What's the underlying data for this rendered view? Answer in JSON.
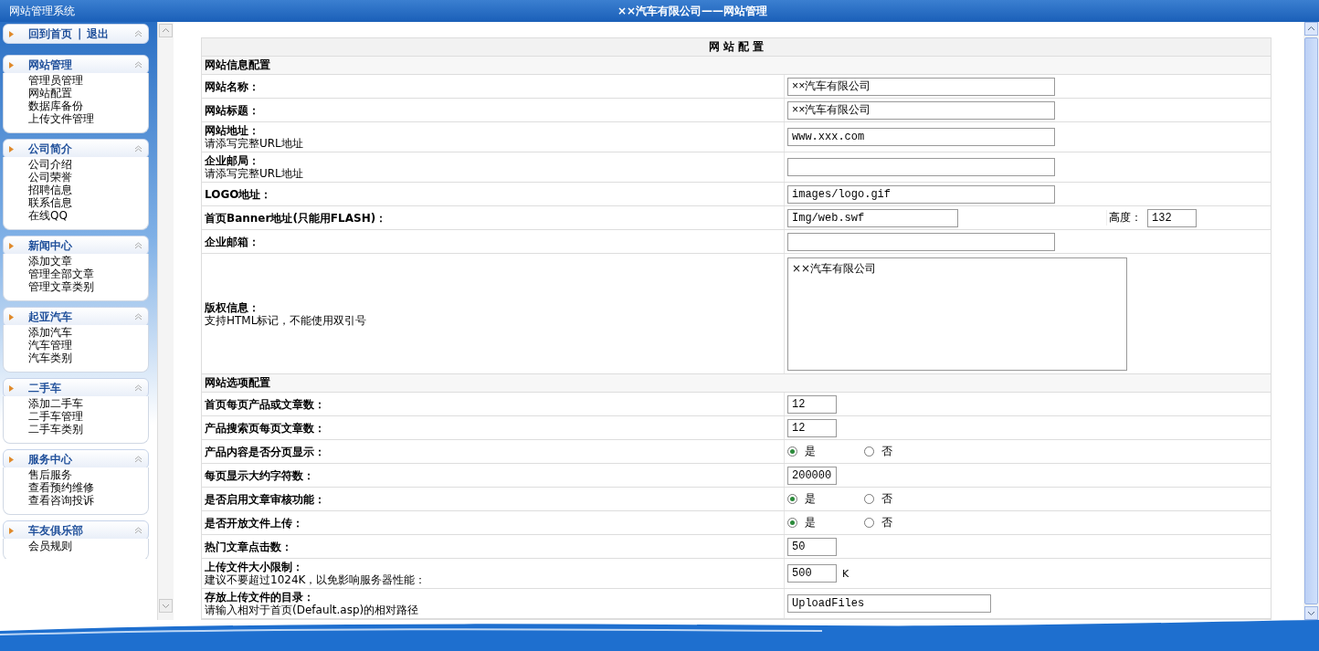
{
  "top_bar": {
    "app_name": "网站管理系统",
    "title": "××汽车有限公司——网站管理"
  },
  "sidebar": {
    "quick_links": [
      {
        "label": "回到首页"
      },
      {
        "label": "退出"
      }
    ],
    "separator": "|",
    "groups": [
      {
        "title": "网站管理",
        "expanded": true,
        "items": [
          "管理员管理",
          "网站配置",
          "数据库备份",
          "上传文件管理"
        ]
      },
      {
        "title": "公司简介",
        "expanded": true,
        "items": [
          "公司介绍",
          "公司荣誉",
          "招聘信息",
          "联系信息",
          "在线QQ"
        ]
      },
      {
        "title": "新闻中心",
        "expanded": true,
        "items": [
          "添加文章",
          "管理全部文章",
          "管理文章类别"
        ]
      },
      {
        "title": "起亚汽车",
        "expanded": true,
        "items": [
          "添加汽车",
          "汽车管理",
          "汽车类别"
        ]
      },
      {
        "title": "二手车",
        "expanded": true,
        "items": [
          "添加二手车",
          "二手车管理",
          "二手车类别"
        ]
      },
      {
        "title": "服务中心",
        "expanded": true,
        "items": [
          "售后服务",
          "查看预约维修",
          "查看咨询投诉"
        ]
      },
      {
        "title": "车友俱乐部",
        "expanded": true,
        "items": [
          "会员规则"
        ]
      }
    ]
  },
  "form": {
    "title": "网 站 配 置",
    "rows": [
      {
        "kind": "section",
        "label": "网站信息配置"
      },
      {
        "kind": "field",
        "label": "网站名称：",
        "control": {
          "kind": "long",
          "value": "××汽车有限公司"
        }
      },
      {
        "kind": "field",
        "label": "网站标题：",
        "control": {
          "kind": "long",
          "value": "××汽车有限公司"
        }
      },
      {
        "kind": "field",
        "label": "网站地址：",
        "hint": "请添写完整URL地址",
        "control": {
          "kind": "long",
          "value": "www.xxx.com"
        }
      },
      {
        "kind": "field",
        "label": "企业邮局：",
        "hint": "请添写完整URL地址",
        "control": {
          "kind": "long"
        }
      },
      {
        "kind": "field",
        "label": "LOGO地址：",
        "control": {
          "kind": "long",
          "value": "images/logo.gif"
        }
      },
      {
        "kind": "field",
        "label": "首页Banner地址(只能用FLASH)：",
        "control": {
          "kind": "banner",
          "value": "Img/web.swf",
          "extra_label": "高度：",
          "extra_value": "132"
        }
      },
      {
        "kind": "field",
        "label": "企业邮箱：",
        "control": {
          "kind": "long"
        }
      },
      {
        "kind": "field",
        "label": "版权信息：",
        "hint": "支持HTML标记，不能使用双引号",
        "control": {
          "kind": "textarea",
          "value": "××汽车有限公司"
        }
      },
      {
        "kind": "section",
        "label": "网站选项配置"
      },
      {
        "kind": "field",
        "label": "首页每页产品或文章数：",
        "control": {
          "kind": "short",
          "value": "12"
        }
      },
      {
        "kind": "field",
        "label": "产品搜索页每页文章数：",
        "control": {
          "kind": "short",
          "value": "12"
        }
      },
      {
        "kind": "field",
        "label": "产品内容是否分页显示：",
        "control": {
          "kind": "radio",
          "options": [
            {
              "label": "是",
              "selected": true
            },
            {
              "label": "否",
              "selected": false
            }
          ]
        }
      },
      {
        "kind": "field",
        "label": "每页显示大约字符数：",
        "control": {
          "kind": "short",
          "value": "200000"
        }
      },
      {
        "kind": "field",
        "label": "是否启用文章审核功能：",
        "control": {
          "kind": "radio",
          "options": [
            {
              "label": "是",
              "selected": true
            },
            {
              "label": "否",
              "selected": false
            }
          ]
        }
      },
      {
        "kind": "field",
        "label": "是否开放文件上传：",
        "control": {
          "kind": "radio",
          "options": [
            {
              "label": "是",
              "selected": true
            },
            {
              "label": "否",
              "selected": false
            }
          ]
        }
      },
      {
        "kind": "field",
        "label": "热门文章点击数：",
        "control": {
          "kind": "short",
          "value": "50"
        }
      },
      {
        "kind": "field",
        "label": "上传文件大小限制：",
        "hint": "建议不要超过1024K，以免影响服务器性能：",
        "control": {
          "kind": "short",
          "value": "500",
          "suffix": "K"
        }
      },
      {
        "kind": "field",
        "label": "存放上传文件的目录：",
        "hint": "请输入相对于首页(Default.asp)的相对路径",
        "control": {
          "kind": "medium",
          "value": "UploadFiles"
        }
      }
    ]
  }
}
